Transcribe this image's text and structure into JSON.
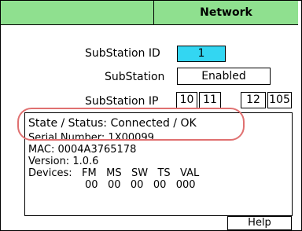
{
  "header": {
    "tab_title": "Network"
  },
  "form": {
    "substation_id_label": "SubStation ID",
    "substation_id_value": "1",
    "substation_label": "SubStation",
    "substation_value": "Enabled",
    "substation_ip_label": "SubStation IP",
    "ip_octets": [
      "10",
      "11",
      "12",
      "105"
    ]
  },
  "status": {
    "state_line": "State / Status: Connected / OK",
    "serial_line": "Serial Number: 1X00099",
    "mac_line": "MAC: 0004A3765178",
    "version_line": "Version: 1.0.6",
    "devices_header": "Devices:   FM   MS   SW   TS   VAL",
    "devices_values": "00   00   00   00   000"
  },
  "buttons": {
    "help_label": "Help"
  },
  "colors": {
    "header_bg": "#8fe08f",
    "id_bg": "#33d6f2",
    "highlight": "#e07070"
  }
}
